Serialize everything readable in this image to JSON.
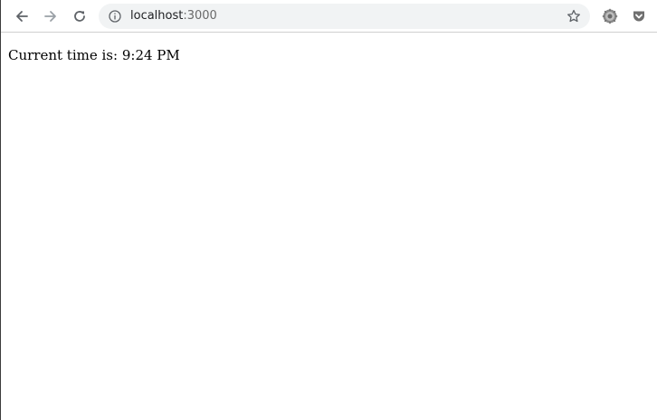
{
  "browser": {
    "url_host": "localhost",
    "url_port": ":3000",
    "icons": {
      "back": "arrow-left-icon",
      "forward": "arrow-right-icon",
      "reload": "reload-icon",
      "site_info": "info-icon",
      "bookmark": "star-icon",
      "extension_1": "gear-extension-icon",
      "extension_2": "pocket-icon"
    },
    "colors": {
      "omnibox_bg": "#f1f3f4",
      "icon_active": "#5f6368",
      "icon_disabled": "#9aa0a6"
    }
  },
  "page": {
    "message_label": "Current time is:",
    "message_time": "9:24 PM"
  }
}
